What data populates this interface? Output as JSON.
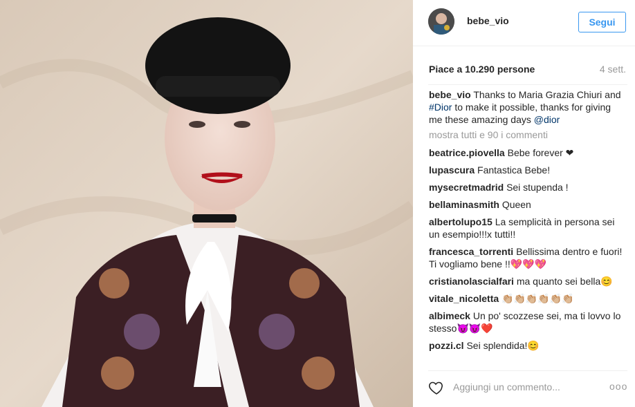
{
  "post": {
    "username": "bebe_vio",
    "follow_label": "Segui",
    "likes_text": "Piace a 10.290 persone",
    "time_ago": "4 sett.",
    "caption": {
      "username": "bebe_vio",
      "text_1": "Thanks to Maria Grazia Chiuri and ",
      "hashtag": "#Dior",
      "text_2": " to make it possible, thanks for giving me these amazing days ",
      "mention": "@dior"
    },
    "view_all_comments": "mostra tutti e 90 i commenti",
    "add_comment_placeholder": "Aggiungi un commento...",
    "more_options": "ooo"
  },
  "comments": [
    {
      "user": "beatrice.piovella",
      "text": "Bebe forever ❤"
    },
    {
      "user": "lupascura",
      "text": "Fantastica Bebe!"
    },
    {
      "user": "mysecretmadrid",
      "text": "Sei stupenda !"
    },
    {
      "user": "bellaminasmith",
      "text": "Queen"
    },
    {
      "user": "albertolupo15",
      "text": "La semplicità in persona sei un esempio!!!x tutti!!"
    },
    {
      "user": "francesca_torrenti",
      "text": "Bellissima dentro e fuori! Ti vogliamo bene !!💖💖💖"
    },
    {
      "user": "cristianolascialfari",
      "text": "ma quanto sei bella😊"
    },
    {
      "user": "vitale_nicoletta",
      "text": "👏🏼👏🏼👏🏼👏🏼👏🏼👏🏼"
    },
    {
      "user": "albimeck",
      "text": "Un po' scozzese sei, ma ti lovvo lo stesso😈😈❤️"
    },
    {
      "user": "pozzi.cl",
      "text": "Sei splendida!😊"
    }
  ],
  "colors": {
    "accent": "#3897f0",
    "text": "#262626",
    "muted": "#999999",
    "hashtag": "#003569"
  }
}
